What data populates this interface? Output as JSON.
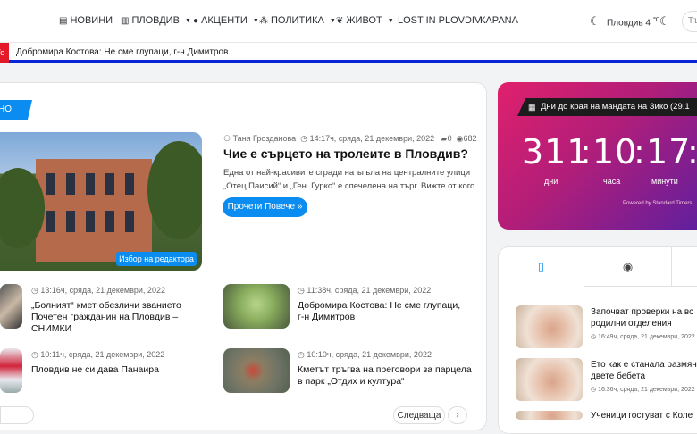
{
  "nav": {
    "items": [
      {
        "label": "НОВИНИ",
        "icon": "newspaper-icon",
        "glyph": "▤",
        "caret": false
      },
      {
        "label": "ПЛОВДИВ",
        "icon": "building-icon",
        "glyph": "▥",
        "caret": true
      },
      {
        "label": "АКЦЕНТИ",
        "icon": "pin-icon",
        "glyph": "●",
        "caret": true
      },
      {
        "label": "ПОЛИТИКА",
        "icon": "people-icon",
        "glyph": "⁂",
        "caret": true
      },
      {
        "label": "ЖИВОТ",
        "icon": "leaf-icon",
        "glyph": "❦",
        "caret": true
      },
      {
        "label": "LOST IN PLOVDIV",
        "icon": "",
        "glyph": "",
        "caret": false
      },
      {
        "label": "КАРАNA",
        "icon": "",
        "glyph": "",
        "caret": false
      }
    ],
    "weather": "Пловдив 4",
    "weather_unit": "℃",
    "search_placeholder": "Тър"
  },
  "ticker": {
    "tag": "Го",
    "text": "Добромира Костова: Не сме глупаци, г-н Димитров"
  },
  "section_tag": "НО",
  "hero": {
    "author": "Таня Грозданова",
    "time": "14:17ч, сряда, 21 декември, 2022",
    "comments": "0",
    "views": "682",
    "title": "Чие е сърцето на тролеите в Пловдив?",
    "excerpt": "Една от най-красивите сгради на ъгъла на централните улици „Отец Паисий“ и „Ген. Гурко“ е спечелена на търг. Вижте от кого",
    "read_more": "Прочети Повече »",
    "badge": "Избор на редактора"
  },
  "posts": [
    {
      "time": "13:16ч, сряда, 21 декември, 2022",
      "title": "„Болният“ кмет обезличи званието Почетен гражданин на Пловдив – СНИМКИ"
    },
    {
      "time": "11:38ч, сряда, 21 декември, 2022",
      "title": "Добромира Костова: Не сме глупаци, г-н Димитров"
    },
    {
      "time": "10:11ч, сряда, 21 декември, 2022",
      "title": "Пловдив не си дава Панаира"
    },
    {
      "time": "10:10ч, сряда, 21 декември, 2022",
      "title": "Кметът тръгва на преговори за парцела в парк „Отдих и култура“"
    }
  ],
  "pagination": {
    "next": "Следваща",
    "arrow": "›"
  },
  "countdown": {
    "header": "Дни до края на мандата на Зико (29.1",
    "days": "311",
    "hours": "10",
    "minutes": "17",
    "extra": ":",
    "days_label": "дни",
    "hours_label": "часа",
    "minutes_label": "минути",
    "credit": "Powered by Standard Timers"
  },
  "side_posts": [
    {
      "title": "Започват проверки на вс родилни отделения",
      "time": "16:49ч, сряда, 21 декември, 2022"
    },
    {
      "title": "Ето как е станала размяна двете бебета",
      "time": "16:36ч, сряда, 21 декември, 2022"
    },
    {
      "title": "Ученици гостуват с Коле",
      "time": ""
    }
  ],
  "colors": {
    "accent": "#0a8cf0",
    "ticker_border": "#0b24d6",
    "ticker_tag": "#e3192b"
  }
}
